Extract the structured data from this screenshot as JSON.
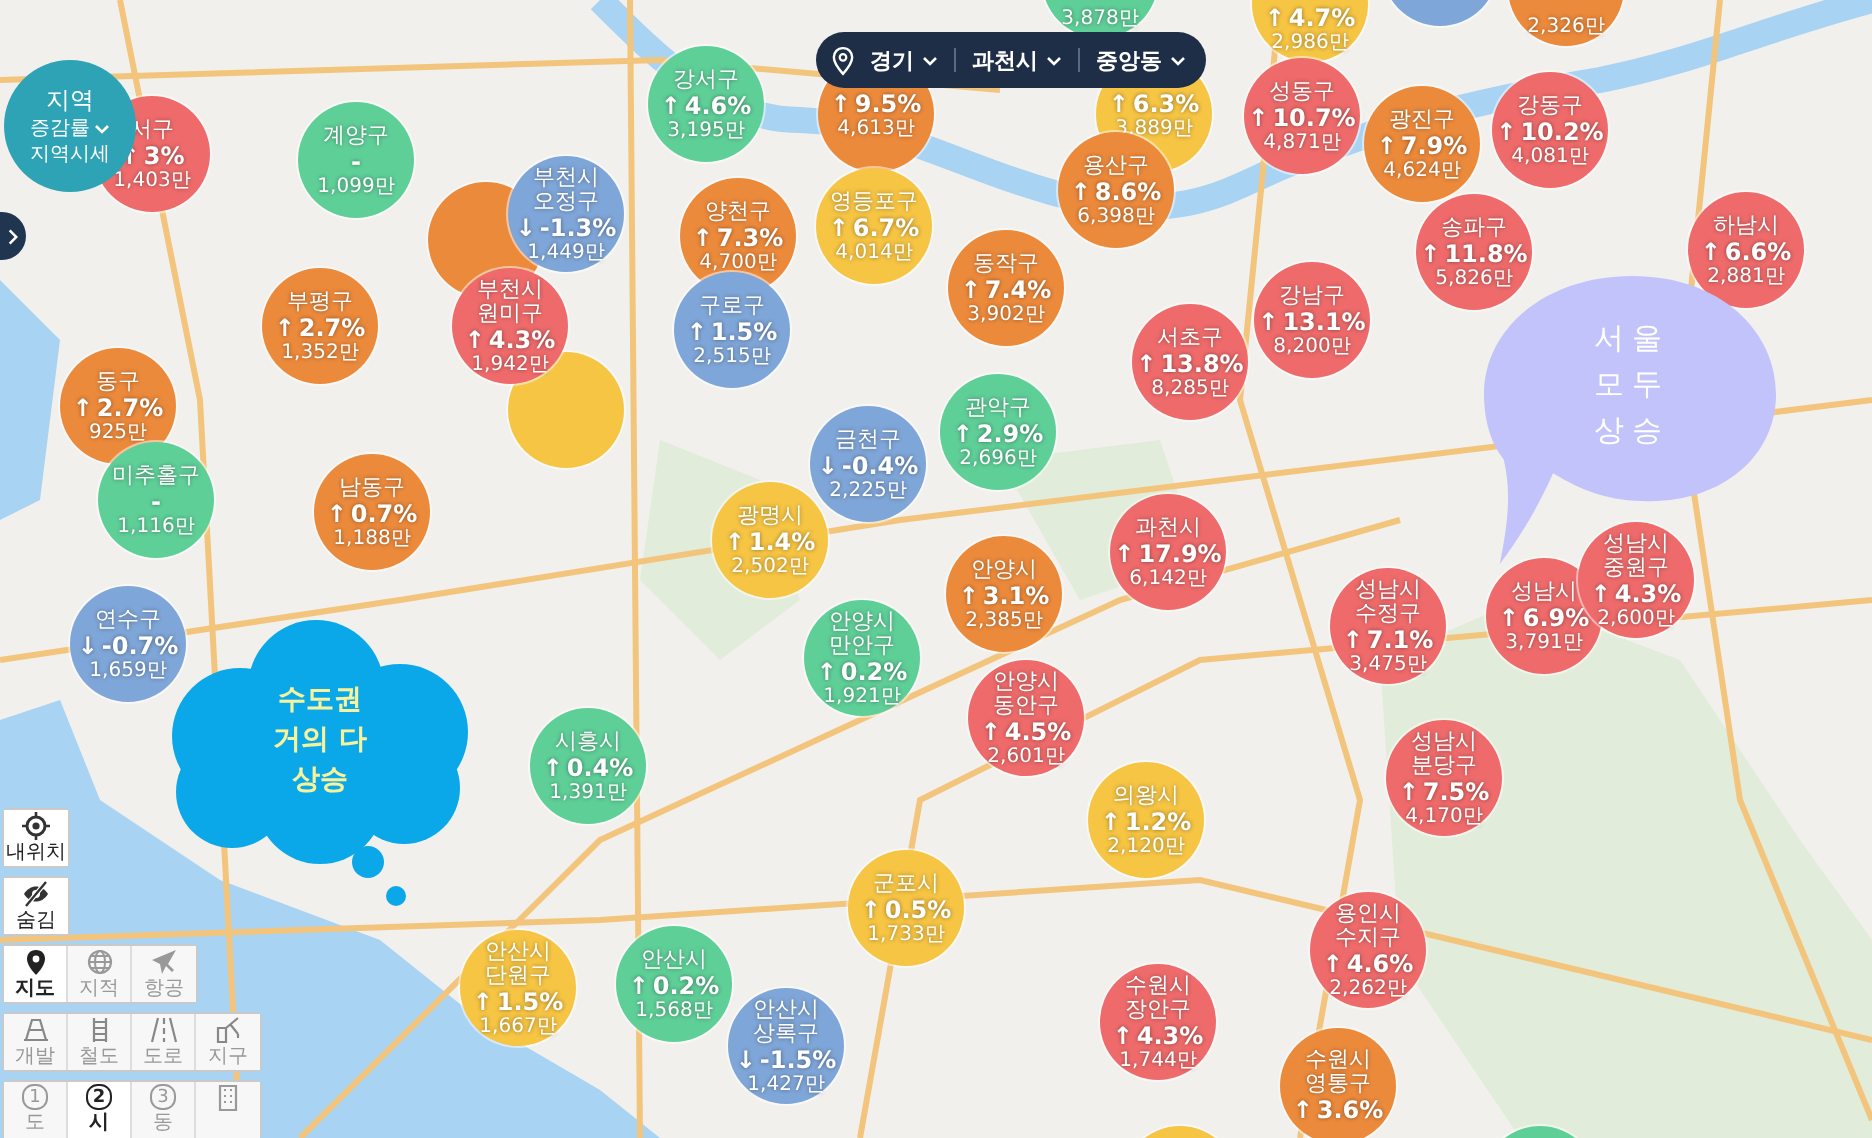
{
  "location_selector": {
    "items": [
      {
        "label": "경기"
      },
      {
        "label": "과천시"
      },
      {
        "label": "중앙동"
      }
    ]
  },
  "legend_badge": {
    "title": "지역",
    "dropdown": "증감률",
    "toggle": "지역시세"
  },
  "regions": [
    {
      "price": "3,878만",
      "color": "#5fcf98"
    },
    {
      "arrow": "↑",
      "change": "4.7%",
      "price": "2,986만",
      "color": "#f7c544"
    },
    {
      "color": "#7fa6d8"
    },
    {
      "price": "2,326만",
      "color": "#ec8a3c"
    },
    {
      "name": "서구",
      "arrow": "↑",
      "change": "3%",
      "price": "1,403만",
      "color": "#ef6b6b"
    },
    {
      "name": "계양구",
      "change": "-",
      "price": "1,099만",
      "color": "#5fcf98"
    },
    {
      "name": "강서구",
      "arrow": "↑",
      "change": "4.6%",
      "price": "3,195만",
      "color": "#5fcf98"
    },
    {
      "arrow": "↑",
      "change": "9.5%",
      "price": "4,613만",
      "color": "#ec8a3c"
    },
    {
      "arrow": "↑",
      "change": "6.3%",
      "price": "3,889만",
      "color": "#f7c544"
    },
    {
      "name": "성동구",
      "arrow": "↑",
      "change": "10.7%",
      "price": "4,871만",
      "color": "#ef6b6b"
    },
    {
      "name": "광진구",
      "arrow": "↑",
      "change": "7.9%",
      "price": "4,624만",
      "color": "#ec8a3c"
    },
    {
      "name": "강동구",
      "arrow": "↑",
      "change": "10.2%",
      "price": "4,081만",
      "color": "#ef6b6b"
    },
    {
      "color": "#ec8a3c"
    },
    {
      "name": "부천시 오정구",
      "arrow": "↓",
      "change": "-1.3%",
      "price": "1,449만",
      "color": "#7fa6d8"
    },
    {
      "name": "양천구",
      "arrow": "↑",
      "change": "7.3%",
      "price": "4,700만",
      "color": "#ec8a3c"
    },
    {
      "name": "영등포구",
      "arrow": "↑",
      "change": "6.7%",
      "price": "4,014만",
      "color": "#f7c544"
    },
    {
      "name": "용산구",
      "arrow": "↑",
      "change": "8.6%",
      "price": "6,398만",
      "color": "#ec8a3c"
    },
    {
      "name": "송파구",
      "arrow": "↑",
      "change": "11.8%",
      "price": "5,826만",
      "color": "#ef6b6b"
    },
    {
      "name": "하남시",
      "arrow": "↑",
      "change": "6.6%",
      "price": "2,881만",
      "color": "#ef6b6b"
    },
    {
      "name": "부평구",
      "arrow": "↑",
      "change": "2.7%",
      "price": "1,352만",
      "color": "#ec8a3c"
    },
    {
      "name": "부천시 원미구",
      "arrow": "↑",
      "change": "4.3%",
      "price": "1,942만",
      "color": "#ef6b6b"
    },
    {
      "name": "구로구",
      "arrow": "↑",
      "change": "1.5%",
      "price": "2,515만",
      "color": "#7fa6d8"
    },
    {
      "name": "동작구",
      "arrow": "↑",
      "change": "7.4%",
      "price": "3,902만",
      "color": "#ec8a3c"
    },
    {
      "name": "서초구",
      "arrow": "↑",
      "change": "13.8%",
      "price": "8,285만",
      "color": "#ef6b6b"
    },
    {
      "name": "강남구",
      "arrow": "↑",
      "change": "13.1%",
      "price": "8,200만",
      "color": "#ef6b6b"
    },
    {
      "name": "동구",
      "arrow": "↑",
      "change": "2.7%",
      "price": "925만",
      "color": "#ec8a3c"
    },
    {
      "color": "#f7c544"
    },
    {
      "name": "금천구",
      "arrow": "↓",
      "change": "-0.4%",
      "price": "2,225만",
      "color": "#7fa6d8"
    },
    {
      "name": "관악구",
      "arrow": "↑",
      "change": "2.9%",
      "price": "2,696만",
      "color": "#5fcf98"
    },
    {
      "name": "미추홀구",
      "change": "-",
      "price": "1,116만",
      "color": "#5fcf98"
    },
    {
      "name": "남동구",
      "arrow": "↑",
      "change": "0.7%",
      "price": "1,188만",
      "color": "#ec8a3c"
    },
    {
      "name": "광명시",
      "arrow": "↑",
      "change": "1.4%",
      "price": "2,502만",
      "color": "#f7c544"
    },
    {
      "name": "과천시",
      "arrow": "↑",
      "change": "17.9%",
      "price": "6,142만",
      "color": "#ef6b6b"
    },
    {
      "name": "연수구",
      "arrow": "↓",
      "change": "-0.7%",
      "price": "1,659만",
      "color": "#7fa6d8"
    },
    {
      "name": "안양시 만안구",
      "arrow": "↑",
      "change": "0.2%",
      "price": "1,921만",
      "color": "#5fcf98"
    },
    {
      "name": "안양시",
      "arrow": "↑",
      "change": "3.1%",
      "price": "2,385만",
      "color": "#ec8a3c"
    },
    {
      "name": "성남시 수정구",
      "arrow": "↑",
      "change": "7.1%",
      "price": "3,475만",
      "color": "#ef6b6b"
    },
    {
      "name": "성남시",
      "arrow": "↑",
      "change": "6.9%",
      "price": "3,791만",
      "color": "#ef6b6b"
    },
    {
      "name": "성남시 중원구",
      "arrow": "↑",
      "change": "4.3%",
      "price": "2,600만",
      "color": "#ef6b6b"
    },
    {
      "name": "시흥시",
      "arrow": "↑",
      "change": "0.4%",
      "price": "1,391만",
      "color": "#5fcf98"
    },
    {
      "name": "안양시 동안구",
      "arrow": "↑",
      "change": "4.5%",
      "price": "2,601만",
      "color": "#ef6b6b"
    },
    {
      "name": "의왕시",
      "arrow": "↑",
      "change": "1.2%",
      "price": "2,120만",
      "color": "#f7c544"
    },
    {
      "name": "성남시 분당구",
      "arrow": "↑",
      "change": "7.5%",
      "price": "4,170만",
      "color": "#ef6b6b"
    },
    {
      "name": "군포시",
      "arrow": "↑",
      "change": "0.5%",
      "price": "1,733만",
      "color": "#f7c544"
    },
    {
      "name": "안산시 단원구",
      "arrow": "↑",
      "change": "1.5%",
      "price": "1,667만",
      "color": "#f7c544"
    },
    {
      "name": "안산시",
      "arrow": "↑",
      "change": "0.2%",
      "price": "1,568만",
      "color": "#5fcf98"
    },
    {
      "name": "안산시 상록구",
      "arrow": "↓",
      "change": "-1.5%",
      "price": "1,427만",
      "color": "#7fa6d8"
    },
    {
      "name": "수원시 장안구",
      "arrow": "↑",
      "change": "4.3%",
      "price": "1,744만",
      "color": "#ef6b6b"
    },
    {
      "name": "용인시 수지구",
      "arrow": "↑",
      "change": "4.6%",
      "price": "2,262만",
      "color": "#ef6b6b"
    },
    {
      "name": "수원시 영통구",
      "arrow": "↑",
      "change": "3.6%",
      "color": "#ec8a3c"
    },
    {
      "color": "#f7c544"
    },
    {
      "color": "#5fcf98"
    }
  ],
  "callouts": [
    {
      "kind": "speech",
      "lines": [
        "서울",
        "모두",
        "상승"
      ]
    },
    {
      "kind": "cloud",
      "lines": [
        "수도권",
        "거의 다",
        "상승"
      ]
    }
  ],
  "toolbar": {
    "actions": [
      {
        "kind": "locate",
        "label": "내위치"
      },
      {
        "kind": "hide",
        "label": "숨김"
      }
    ],
    "map_types": [
      {
        "kind": "map",
        "label": "지도",
        "selected": true
      },
      {
        "kind": "cadastral",
        "label": "지적",
        "selected": false
      },
      {
        "kind": "satellite",
        "label": "항공",
        "selected": false
      }
    ],
    "overlays": [
      {
        "kind": "development",
        "label": "개발"
      },
      {
        "kind": "rail",
        "label": "철도"
      },
      {
        "kind": "road",
        "label": "도로"
      },
      {
        "kind": "district",
        "label": "지구"
      }
    ],
    "levels": [
      {
        "kind": "number",
        "number": "1",
        "label": "도",
        "selected": false
      },
      {
        "kind": "number",
        "number": "2",
        "label": "시",
        "selected": true
      },
      {
        "kind": "number",
        "number": "3",
        "label": "동",
        "selected": false
      },
      {
        "kind": "building",
        "selected": false
      }
    ]
  }
}
